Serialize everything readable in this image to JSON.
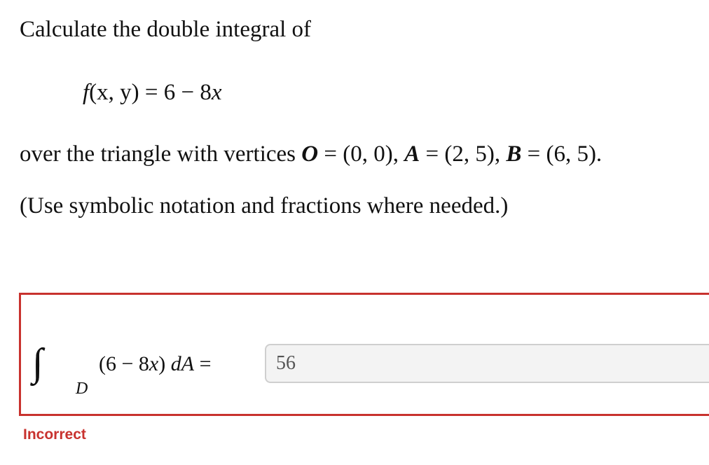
{
  "question": {
    "prompt": "Calculate the double integral of",
    "function": {
      "lhs_name": "f",
      "lhs_args": "(x, y)",
      "equals": "=",
      "rhs_const": "6 −",
      "rhs_coef": "8",
      "rhs_var": "x"
    },
    "vertices": {
      "lead": "over the triangle with vertices",
      "o_name": "O",
      "o_val": "= (0, 0),",
      "a_name": "A",
      "a_val": "= (2, 5),",
      "b_name": "B",
      "b_val": "= (6, 5)."
    },
    "note": "(Use symbolic notation and fractions where needed.)"
  },
  "answer": {
    "integral_region": "D",
    "integrand_open": "(6 − 8",
    "integrand_var": "x",
    "integrand_close": ")",
    "differential": "dA",
    "equals": "=",
    "input_value": "56",
    "status_text": "Incorrect",
    "status_color": "#c8322e"
  }
}
